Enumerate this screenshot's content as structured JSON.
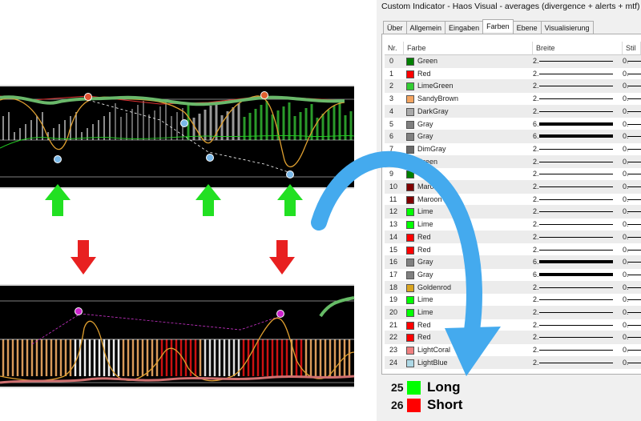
{
  "dialog": {
    "title": "Custom Indicator - Haos Visual - averages (divergence + alerts + mtf)",
    "tabs": [
      "Über",
      "Allgemein",
      "Eingaben",
      "Farben",
      "Ebene",
      "Visualisierung"
    ],
    "active_tab": "Farben",
    "columns": {
      "nr": "Nr.",
      "farbe": "Farbe",
      "breite": "Breite",
      "stil": "Stil"
    },
    "rows": [
      {
        "nr": "0",
        "color_name": "Green",
        "hex": "#008000",
        "width": "2.",
        "thick": false,
        "style": "0."
      },
      {
        "nr": "1",
        "color_name": "Red",
        "hex": "#ff0000",
        "width": "2.",
        "thick": false,
        "style": "0."
      },
      {
        "nr": "2",
        "color_name": "LimeGreen",
        "hex": "#32cd32",
        "width": "2.",
        "thick": false,
        "style": "0."
      },
      {
        "nr": "3",
        "color_name": "SandyBrown",
        "hex": "#f4a460",
        "width": "2.",
        "thick": false,
        "style": "0."
      },
      {
        "nr": "4",
        "color_name": "DarkGray",
        "hex": "#a9a9a9",
        "width": "2.",
        "thick": false,
        "style": "0."
      },
      {
        "nr": "5",
        "color_name": "Gray",
        "hex": "#808080",
        "width": "6.",
        "thick": true,
        "style": "0."
      },
      {
        "nr": "6",
        "color_name": "Gray",
        "hex": "#808080",
        "width": "6.",
        "thick": true,
        "style": "0."
      },
      {
        "nr": "7",
        "color_name": "DimGray",
        "hex": "#696969",
        "width": "2.",
        "thick": false,
        "style": "0."
      },
      {
        "nr": "8",
        "color_name": "Green",
        "hex": "#008000",
        "width": "2.",
        "thick": false,
        "style": "0."
      },
      {
        "nr": "9",
        "color_name": "Green",
        "hex": "#008000",
        "width": "2.",
        "thick": false,
        "style": "0."
      },
      {
        "nr": "10",
        "color_name": "Maroon",
        "hex": "#800000",
        "width": "2.",
        "thick": false,
        "style": "0."
      },
      {
        "nr": "11",
        "color_name": "Maroon",
        "hex": "#800000",
        "width": "2.",
        "thick": false,
        "style": "0."
      },
      {
        "nr": "12",
        "color_name": "Lime",
        "hex": "#00ff00",
        "width": "2.",
        "thick": false,
        "style": "0."
      },
      {
        "nr": "13",
        "color_name": "Lime",
        "hex": "#00ff00",
        "width": "2.",
        "thick": false,
        "style": "0."
      },
      {
        "nr": "14",
        "color_name": "Red",
        "hex": "#ff0000",
        "width": "2.",
        "thick": false,
        "style": "0."
      },
      {
        "nr": "15",
        "color_name": "Red",
        "hex": "#ff0000",
        "width": "2.",
        "thick": false,
        "style": "0."
      },
      {
        "nr": "16",
        "color_name": "Gray",
        "hex": "#808080",
        "width": "6.",
        "thick": true,
        "style": "0."
      },
      {
        "nr": "17",
        "color_name": "Gray",
        "hex": "#808080",
        "width": "6.",
        "thick": true,
        "style": "0."
      },
      {
        "nr": "18",
        "color_name": "Goldenrod",
        "hex": "#daa520",
        "width": "2.",
        "thick": false,
        "style": "0."
      },
      {
        "nr": "19",
        "color_name": "Lime",
        "hex": "#00ff00",
        "width": "2.",
        "thick": false,
        "style": "0."
      },
      {
        "nr": "20",
        "color_name": "Lime",
        "hex": "#00ff00",
        "width": "2.",
        "thick": false,
        "style": "0."
      },
      {
        "nr": "21",
        "color_name": "Red",
        "hex": "#ff0000",
        "width": "2.",
        "thick": false,
        "style": "0."
      },
      {
        "nr": "22",
        "color_name": "Red",
        "hex": "#ff0000",
        "width": "2.",
        "thick": false,
        "style": "0."
      },
      {
        "nr": "23",
        "color_name": "LightCoral",
        "hex": "#f08080",
        "width": "2.",
        "thick": false,
        "style": "0."
      },
      {
        "nr": "24",
        "color_name": "LightBlue",
        "hex": "#add8e6",
        "width": "2.",
        "thick": false,
        "style": "0."
      }
    ]
  },
  "legend": [
    {
      "num": "25",
      "label": "Long",
      "hex": "#00ff00"
    },
    {
      "num": "26",
      "label": "Short",
      "hex": "#ff0000"
    }
  ],
  "colors": {
    "chart_bg": "#000000",
    "up_arrow": "#22e022",
    "down_arrow": "#e82020",
    "curved_arrow": "#44aaee"
  }
}
